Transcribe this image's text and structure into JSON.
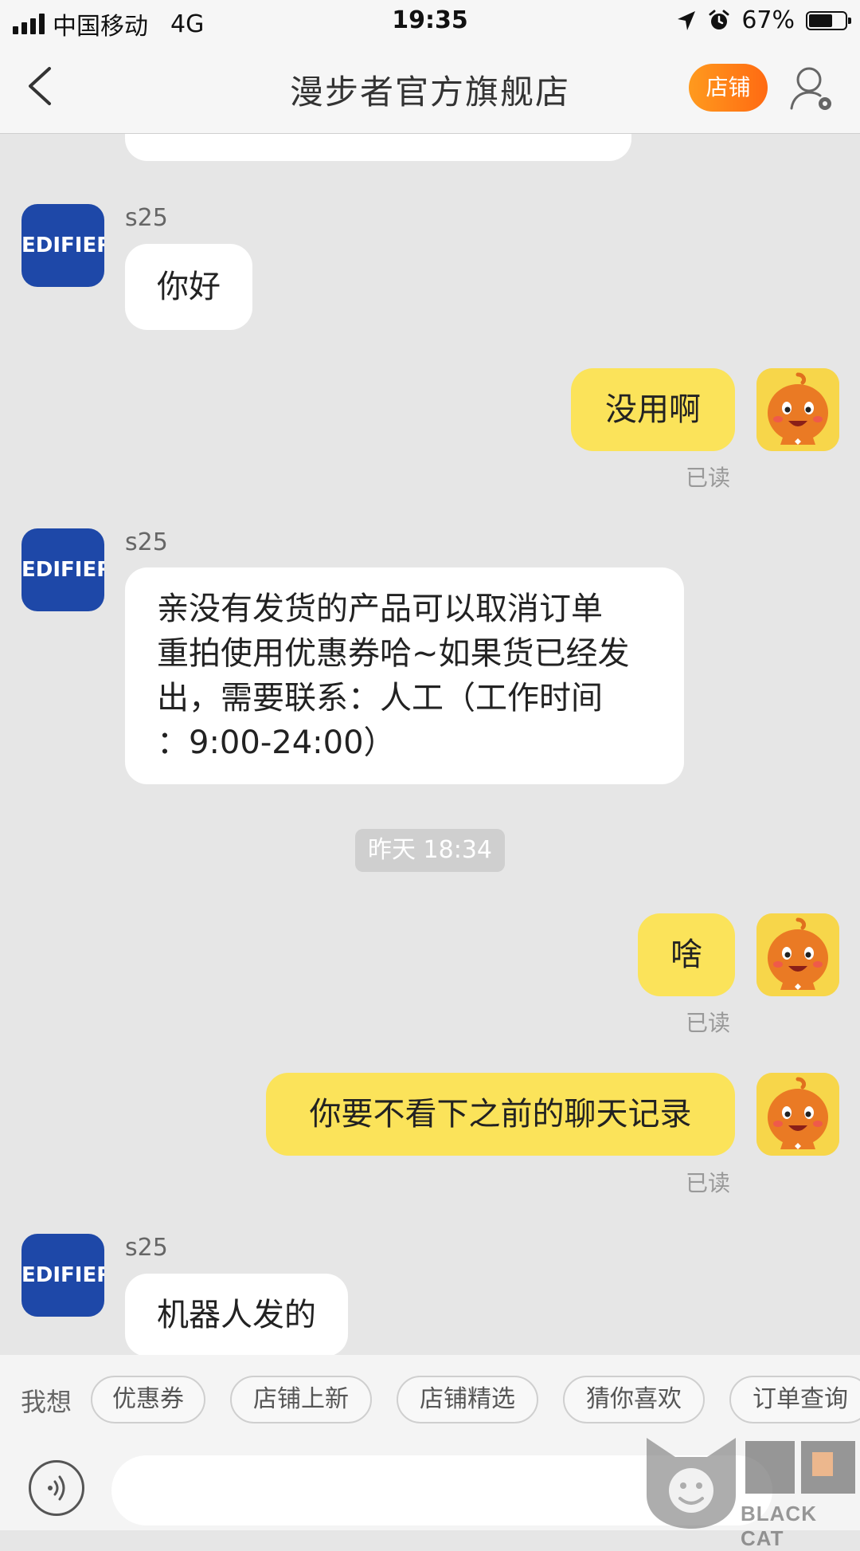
{
  "status_bar": {
    "carrier": "中国移动",
    "network": "4G",
    "time": "19:35",
    "battery": "67%",
    "battery_level": 0.67,
    "icons": [
      "signal-icon",
      "location-icon",
      "alarm-icon",
      "battery-icon"
    ]
  },
  "nav": {
    "title": "漫步者官方旗舰店",
    "store_label": "店铺",
    "icons": [
      "back-arrow-icon",
      "profile-settings-icon"
    ],
    "accent_color": "#ff7a16"
  },
  "chat": {
    "messages": [
      {
        "sender": "s25",
        "text": "你好"
      },
      {
        "text": "没用啊",
        "status": "已读"
      },
      {
        "sender": "s25",
        "lines": [
          "亲没有发货的产品可以取消订单",
          "重拍使用优惠券哈~如果货已经发",
          "出，需要联系：人工（工作时间",
          "：9:00-24:00）"
        ]
      },
      {
        "text": "啥",
        "status": "已读"
      },
      {
        "text": "你要不看下之前的聊天记录",
        "status": "已读"
      },
      {
        "sender": "s25",
        "text": "机器人发的"
      }
    ],
    "timestamp": "昨天 18:34",
    "shop_avatar_text": "EDIFIER",
    "shop_color": "#1e48a8",
    "my_bubble_color": "#fbe35a"
  },
  "quick_bar": {
    "label": "我想",
    "chips": [
      "优惠券",
      "店铺上新",
      "店铺精选",
      "猜你喜欢",
      "订单查询"
    ]
  },
  "input_bar": {
    "placeholder": "",
    "icons": [
      "voice-icon"
    ]
  },
  "watermark": {
    "text": "BLACK CAT",
    "logo_text": "黑猫"
  }
}
